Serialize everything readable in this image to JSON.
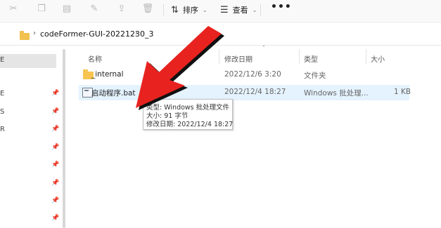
{
  "toolbar": {
    "icons": [
      "cut-icon",
      "copy-icon",
      "paste-icon",
      "rename-icon",
      "share-icon",
      "delete-icon"
    ],
    "sort_label": "排序",
    "view_label": "查看",
    "more_label": "•••"
  },
  "address": {
    "path": "codeFormer-GUI-20221230_3"
  },
  "nav": {
    "selected_label": "E",
    "items": [
      {
        "label": "E",
        "pinned": true
      },
      {
        "label": "S",
        "pinned": true
      },
      {
        "label": "R",
        "pinned": true
      },
      {
        "label": "",
        "pinned": true
      },
      {
        "label": "",
        "pinned": true
      },
      {
        "label": "",
        "pinned": true
      },
      {
        "label": "",
        "pinned": true
      },
      {
        "label": "",
        "pinned": true
      }
    ]
  },
  "columns": {
    "name": "名称",
    "modified": "修改日期",
    "type": "类型",
    "size": "大小"
  },
  "files": [
    {
      "name": "_internal",
      "modified": "2022/12/6 3:20",
      "type": "文件夹",
      "size": "",
      "icon": "folder-icon"
    },
    {
      "name": "启动程序.bat",
      "modified": "2022/12/4 18:27",
      "type": "Windows 批处理...",
      "size": "1 KB",
      "icon": "bat-file-icon"
    }
  ],
  "tooltip": {
    "type_line": "类型: Windows 批处理文件",
    "size_line": "大小: 91 字节",
    "modified_line": "修改日期: 2022/12/4 18:27"
  },
  "colors": {
    "arrow": "#e8231f",
    "hover_row": "#e5f3ff",
    "folder": "#f6c44f"
  }
}
